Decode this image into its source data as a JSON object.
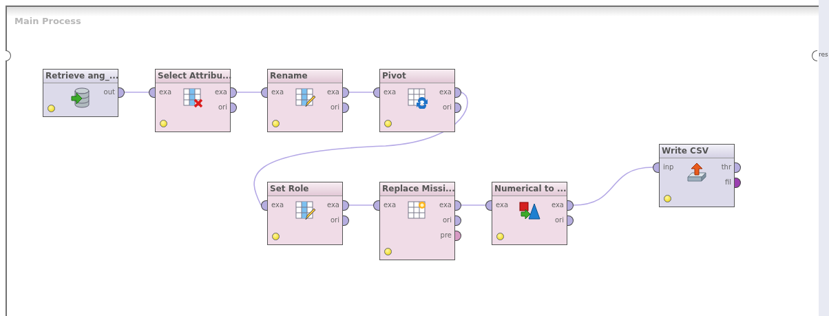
{
  "process": {
    "title": "Main Process",
    "output_port": {
      "label": "res"
    }
  },
  "operators": [
    {
      "title": "Retrieve ang_...",
      "kind": "io",
      "outputs": [
        {
          "label": "out",
          "color": "#b6aee0"
        }
      ]
    },
    {
      "title": "Select Attribu...",
      "kind": "transform",
      "inputs": [
        {
          "label": "exa",
          "color": "#b6aee0"
        }
      ],
      "outputs": [
        {
          "label": "exa",
          "color": "#b6aee0"
        },
        {
          "label": "ori",
          "color": "#b6aee0"
        }
      ]
    },
    {
      "title": "Rename",
      "kind": "transform",
      "inputs": [
        {
          "label": "exa",
          "color": "#b6aee0"
        }
      ],
      "outputs": [
        {
          "label": "exa",
          "color": "#b6aee0"
        },
        {
          "label": "ori",
          "color": "#b6aee0"
        }
      ]
    },
    {
      "title": "Pivot",
      "kind": "transform",
      "inputs": [
        {
          "label": "exa",
          "color": "#b6aee0"
        }
      ],
      "outputs": [
        {
          "label": "exa",
          "color": "#b6aee0"
        },
        {
          "label": "ori",
          "color": "#b6aee0"
        }
      ]
    },
    {
      "title": "Set Role",
      "kind": "transform",
      "inputs": [
        {
          "label": "exa",
          "color": "#b6aee0"
        }
      ],
      "outputs": [
        {
          "label": "exa",
          "color": "#b6aee0"
        },
        {
          "label": "ori",
          "color": "#b6aee0"
        }
      ]
    },
    {
      "title": "Replace Missi...",
      "kind": "transform",
      "inputs": [
        {
          "label": "exa",
          "color": "#b6aee0"
        }
      ],
      "outputs": [
        {
          "label": "exa",
          "color": "#b6aee0"
        },
        {
          "label": "ori",
          "color": "#b6aee0"
        },
        {
          "label": "pre",
          "color": "#d79ac4"
        }
      ]
    },
    {
      "title": "Numerical to ...",
      "kind": "transform",
      "inputs": [
        {
          "label": "exa",
          "color": "#b6aee0"
        }
      ],
      "outputs": [
        {
          "label": "exa",
          "color": "#b6aee0"
        },
        {
          "label": "ori",
          "color": "#b6aee0"
        }
      ]
    },
    {
      "title": "Write CSV",
      "kind": "io",
      "inputs": [
        {
          "label": "inp",
          "color": "#b6aee0"
        }
      ],
      "outputs": [
        {
          "label": "thr",
          "color": "#b6aee0"
        },
        {
          "label": "fil",
          "color": "#9a3fb0"
        }
      ]
    }
  ]
}
